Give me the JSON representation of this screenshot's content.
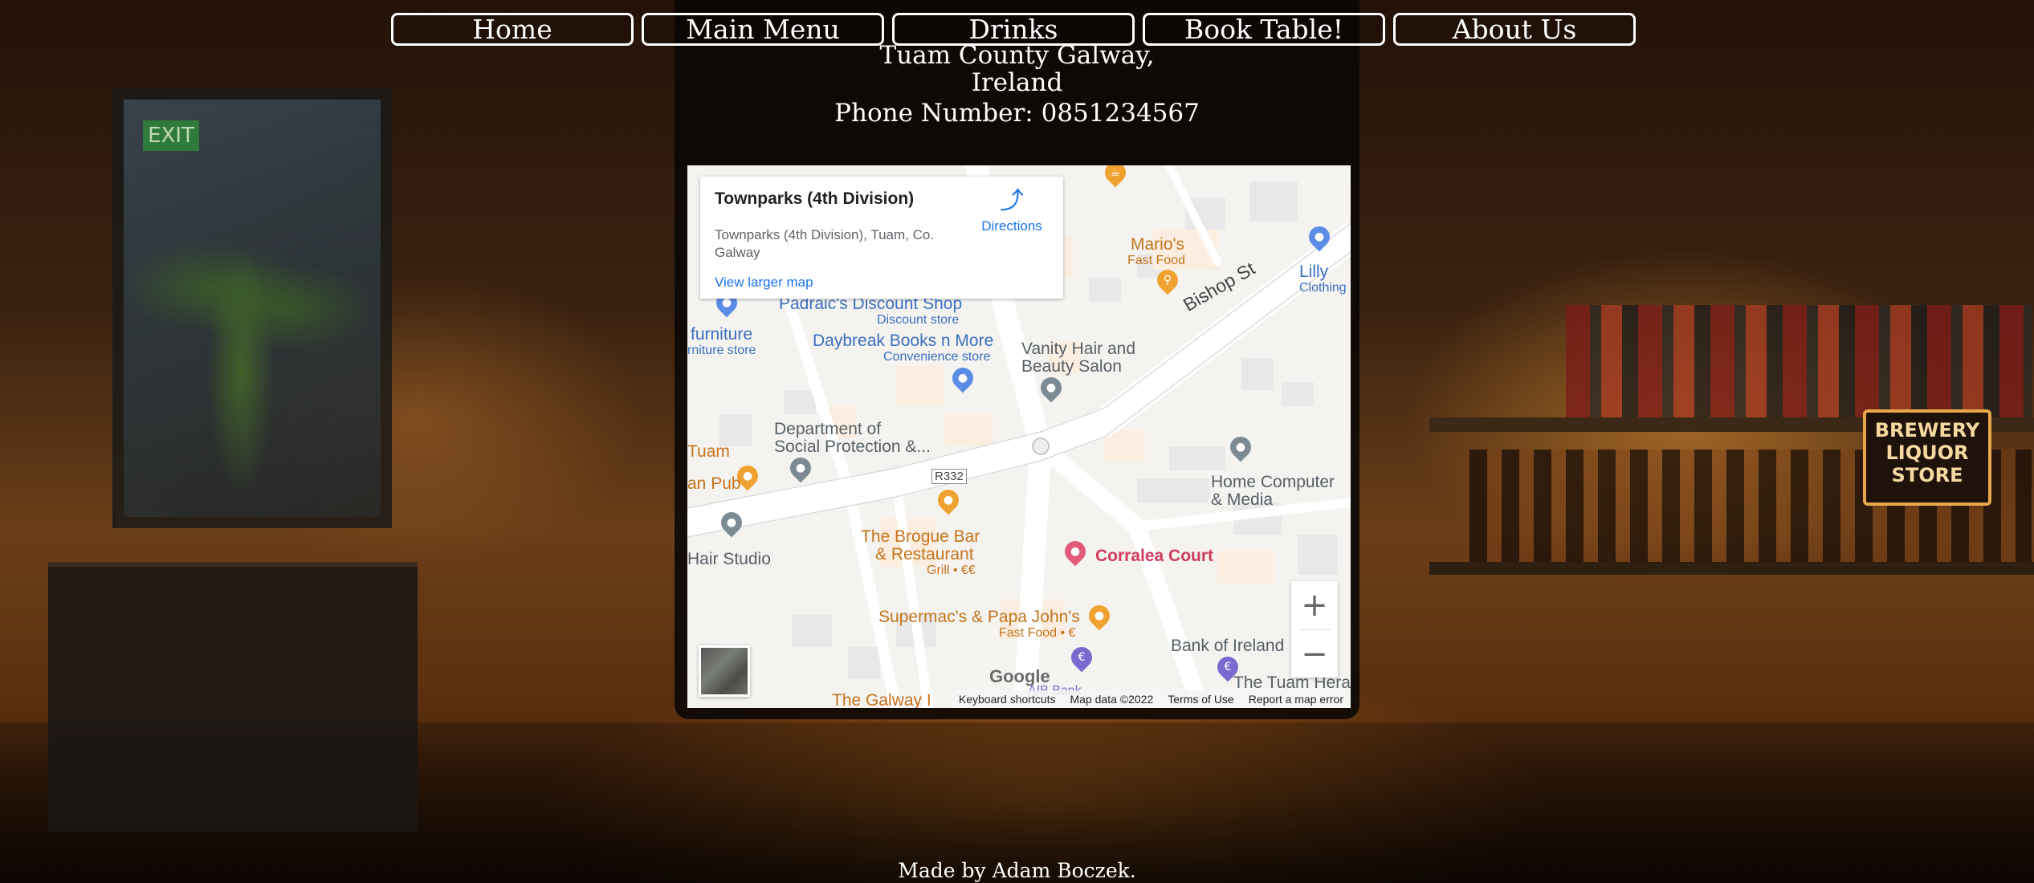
{
  "nav": {
    "items": [
      {
        "label": "Home"
      },
      {
        "label": "Main Menu"
      },
      {
        "label": "Drinks"
      },
      {
        "label": "Book Table!"
      },
      {
        "label": "About Us"
      }
    ]
  },
  "contact": {
    "address_line1": "Tuam County Galway,",
    "address_line2": "Ireland",
    "phone": "Phone Number: 0851234567"
  },
  "map": {
    "card": {
      "title": "Townparks (4th Division)",
      "address": "Townparks (4th Division), Tuam, Co. Galway",
      "directions_label": "Directions",
      "larger_map_label": "View larger map"
    },
    "places": {
      "padraics": "Padraic's Discount Shop",
      "padraics_sub": "Discount store",
      "daybreak": "Daybreak Books n More",
      "daybreak_sub": "Convenience store",
      "vanity_1": "Vanity Hair and",
      "vanity_2": "Beauty Salon",
      "dept_1": "Department of",
      "dept_2": "Social Protection &...",
      "marios": "Mario's",
      "marios_sub": "Fast Food",
      "lilly_1": "Lilly",
      "lilly_2": "Clothing",
      "bishop": "Bishop St",
      "tuam": "Tuam",
      "pub": "an Pub",
      "furniture": "furniture",
      "furniture_sub": "rniture store",
      "hair_studio": "Hair Studio",
      "r332": "R332",
      "brogue_1": "The Brogue Bar",
      "brogue_2": "& Restaurant",
      "brogue_sub": "Grill • €€",
      "corralea": "Corralea Court",
      "home_computer_1": "Home Computer",
      "home_computer_2": "& Media",
      "supermacs": "Supermac's & Papa John's",
      "supermacs_sub": "Fast Food • €",
      "bank": "Bank of Ireland",
      "tuam_hera": "The Tuam Hera",
      "galway": "The Galway I",
      "aib": "AIB Bank"
    },
    "google": "Google",
    "attribution": [
      "Keyboard shortcuts",
      "Map data ©2022",
      "Terms of Use",
      "Report a map error"
    ]
  },
  "footer": {
    "text": "Made by Adam Boczek."
  },
  "colors": {
    "accent": "#ffffff",
    "map_link": "#1a73e8",
    "poi_orange": "#c5741a",
    "poi_blue": "#3b6fbf",
    "poi_red": "#d23a5e"
  }
}
